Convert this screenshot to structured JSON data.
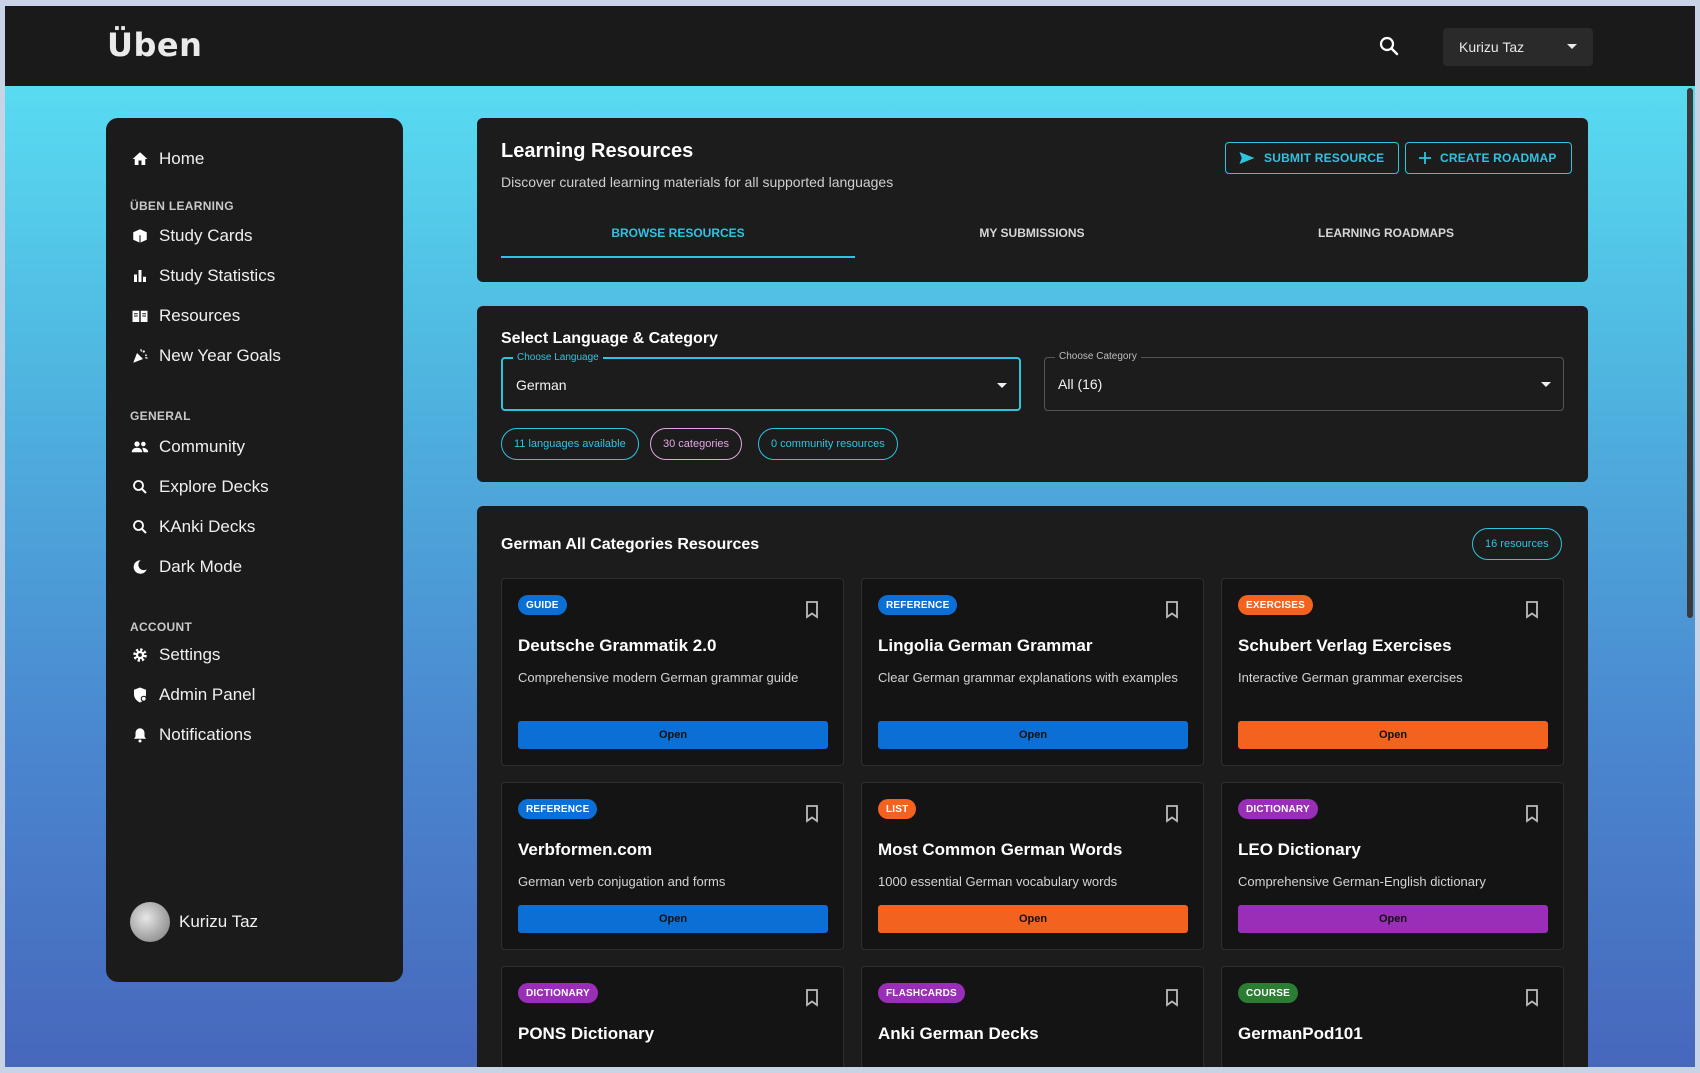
{
  "app": {
    "logo": "Üben"
  },
  "header": {
    "user_name": "Kurizu Taz"
  },
  "sidebar": {
    "home": "Home",
    "section_learning": "ÜBEN LEARNING",
    "study_cards": "Study Cards",
    "study_statistics": "Study Statistics",
    "resources": "Resources",
    "new_year_goals": "New Year Goals",
    "section_general": "GENERAL",
    "community": "Community",
    "explore_decks": "Explore Decks",
    "kanki_decks": "KAnki Decks",
    "dark_mode": "Dark Mode",
    "section_account": "ACCOUNT",
    "settings": "Settings",
    "admin_panel": "Admin Panel",
    "notifications": "Notifications",
    "profile_name": "Kurizu Taz"
  },
  "resources_panel": {
    "title": "Learning Resources",
    "subtitle": "Discover curated learning materials for all supported languages",
    "submit_button": "SUBMIT RESOURCE",
    "create_button": "CREATE ROADMAP",
    "tabs": [
      "BROWSE RESOURCES",
      "MY SUBMISSIONS",
      "LEARNING ROADMAPS"
    ]
  },
  "filter_panel": {
    "title": "Select Language & Category",
    "language_label": "Choose Language",
    "language_value": "German",
    "category_label": "Choose Category",
    "category_value": "All (16)",
    "chips": [
      "11 languages available",
      "30 categories",
      "0 community resources"
    ]
  },
  "list_panel": {
    "title": "German All Categories Resources",
    "count_chip": "16 resources",
    "open_label": "Open",
    "cards": [
      {
        "badge": "GUIDE",
        "title": "Deutsche Grammatik 2.0",
        "desc": "Comprehensive modern German grammar guide"
      },
      {
        "badge": "REFERENCE",
        "title": "Lingolia German Grammar",
        "desc": "Clear German grammar explanations with examples"
      },
      {
        "badge": "EXERCISES",
        "title": "Schubert Verlag Exercises",
        "desc": "Interactive German grammar exercises"
      },
      {
        "badge": "REFERENCE",
        "title": "Verbformen.com",
        "desc": "German verb conjugation and forms"
      },
      {
        "badge": "LIST",
        "title": "Most Common German Words",
        "desc": "1000 essential German vocabulary words"
      },
      {
        "badge": "DICTIONARY",
        "title": "LEO Dictionary",
        "desc": "Comprehensive German-English dictionary"
      },
      {
        "badge": "DICTIONARY",
        "title": "PONS Dictionary",
        "desc": ""
      },
      {
        "badge": "FLASHCARDS",
        "title": "Anki German Decks",
        "desc": ""
      },
      {
        "badge": "COURSE",
        "title": "GermanPod101",
        "desc": ""
      }
    ]
  },
  "colors": {
    "accent": "#2ec4e0",
    "blue": "#0b6fd6",
    "orange": "#f4621f",
    "purple": "#9a2eb8",
    "green": "#2b7d34"
  }
}
